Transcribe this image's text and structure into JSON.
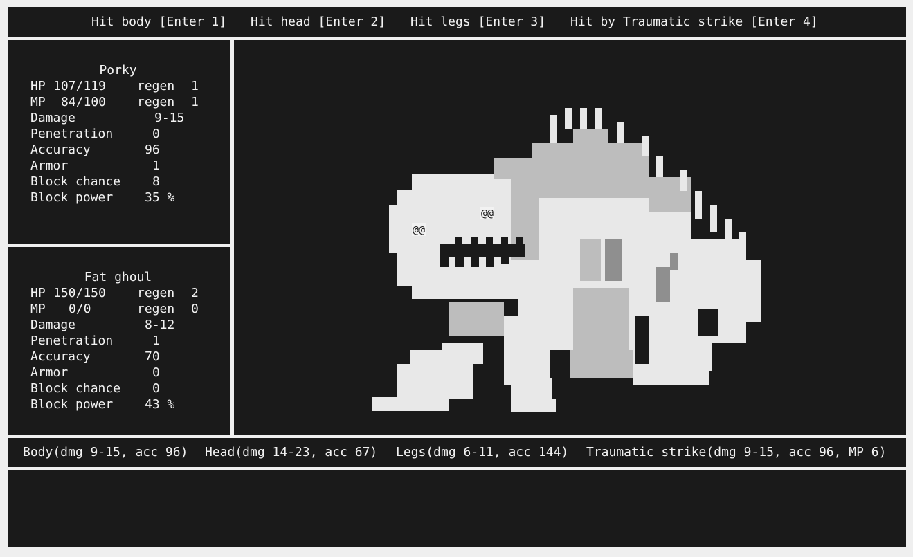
{
  "actions": [
    {
      "label": "Hit body [Enter 1]"
    },
    {
      "label": "Hit head [Enter 2]"
    },
    {
      "label": "Hit legs [Enter 3]"
    },
    {
      "label": "Hit by Traumatic strike [Enter 4]"
    }
  ],
  "player": {
    "name": "Porky",
    "hp": "107/119",
    "hp_regen": "1",
    "mp": "84/100",
    "mp_regen": "1",
    "damage": "9-15",
    "penetration": "0",
    "accuracy": "96",
    "armor": "1",
    "block_chance": "8",
    "block_power": "35 %"
  },
  "enemy": {
    "name": "Fat ghoul",
    "hp": "150/150",
    "hp_regen": "2",
    "mp": "0/0",
    "mp_regen": "0",
    "damage": "8-12",
    "penetration": "1",
    "accuracy": "70",
    "armor": "0",
    "block_chance": "0",
    "block_power": "43 %"
  },
  "labels": {
    "hp": "HP",
    "mp": "MP",
    "regen": "regen",
    "damage": "Damage",
    "penetration": "Penetration",
    "accuracy": "Accuracy",
    "armor": "Armor",
    "block_chance": "Block chance",
    "block_power": "Block power"
  },
  "attacks": [
    {
      "label": "Body(dmg 9-15, acc 96)"
    },
    {
      "label": "Head(dmg 14-23, acc 67)"
    },
    {
      "label": "Legs(dmg 6-11, acc 144)"
    },
    {
      "label": "Traumatic strike(dmg 9-15, acc 96, MP 6)"
    }
  ],
  "monster": {
    "eye_glyph": "@@",
    "colors": {
      "light": "#e8e8e8",
      "mid": "#bdbdbd",
      "dark": "#8f8f8f",
      "bg": "#1a1a1a"
    }
  },
  "log": []
}
